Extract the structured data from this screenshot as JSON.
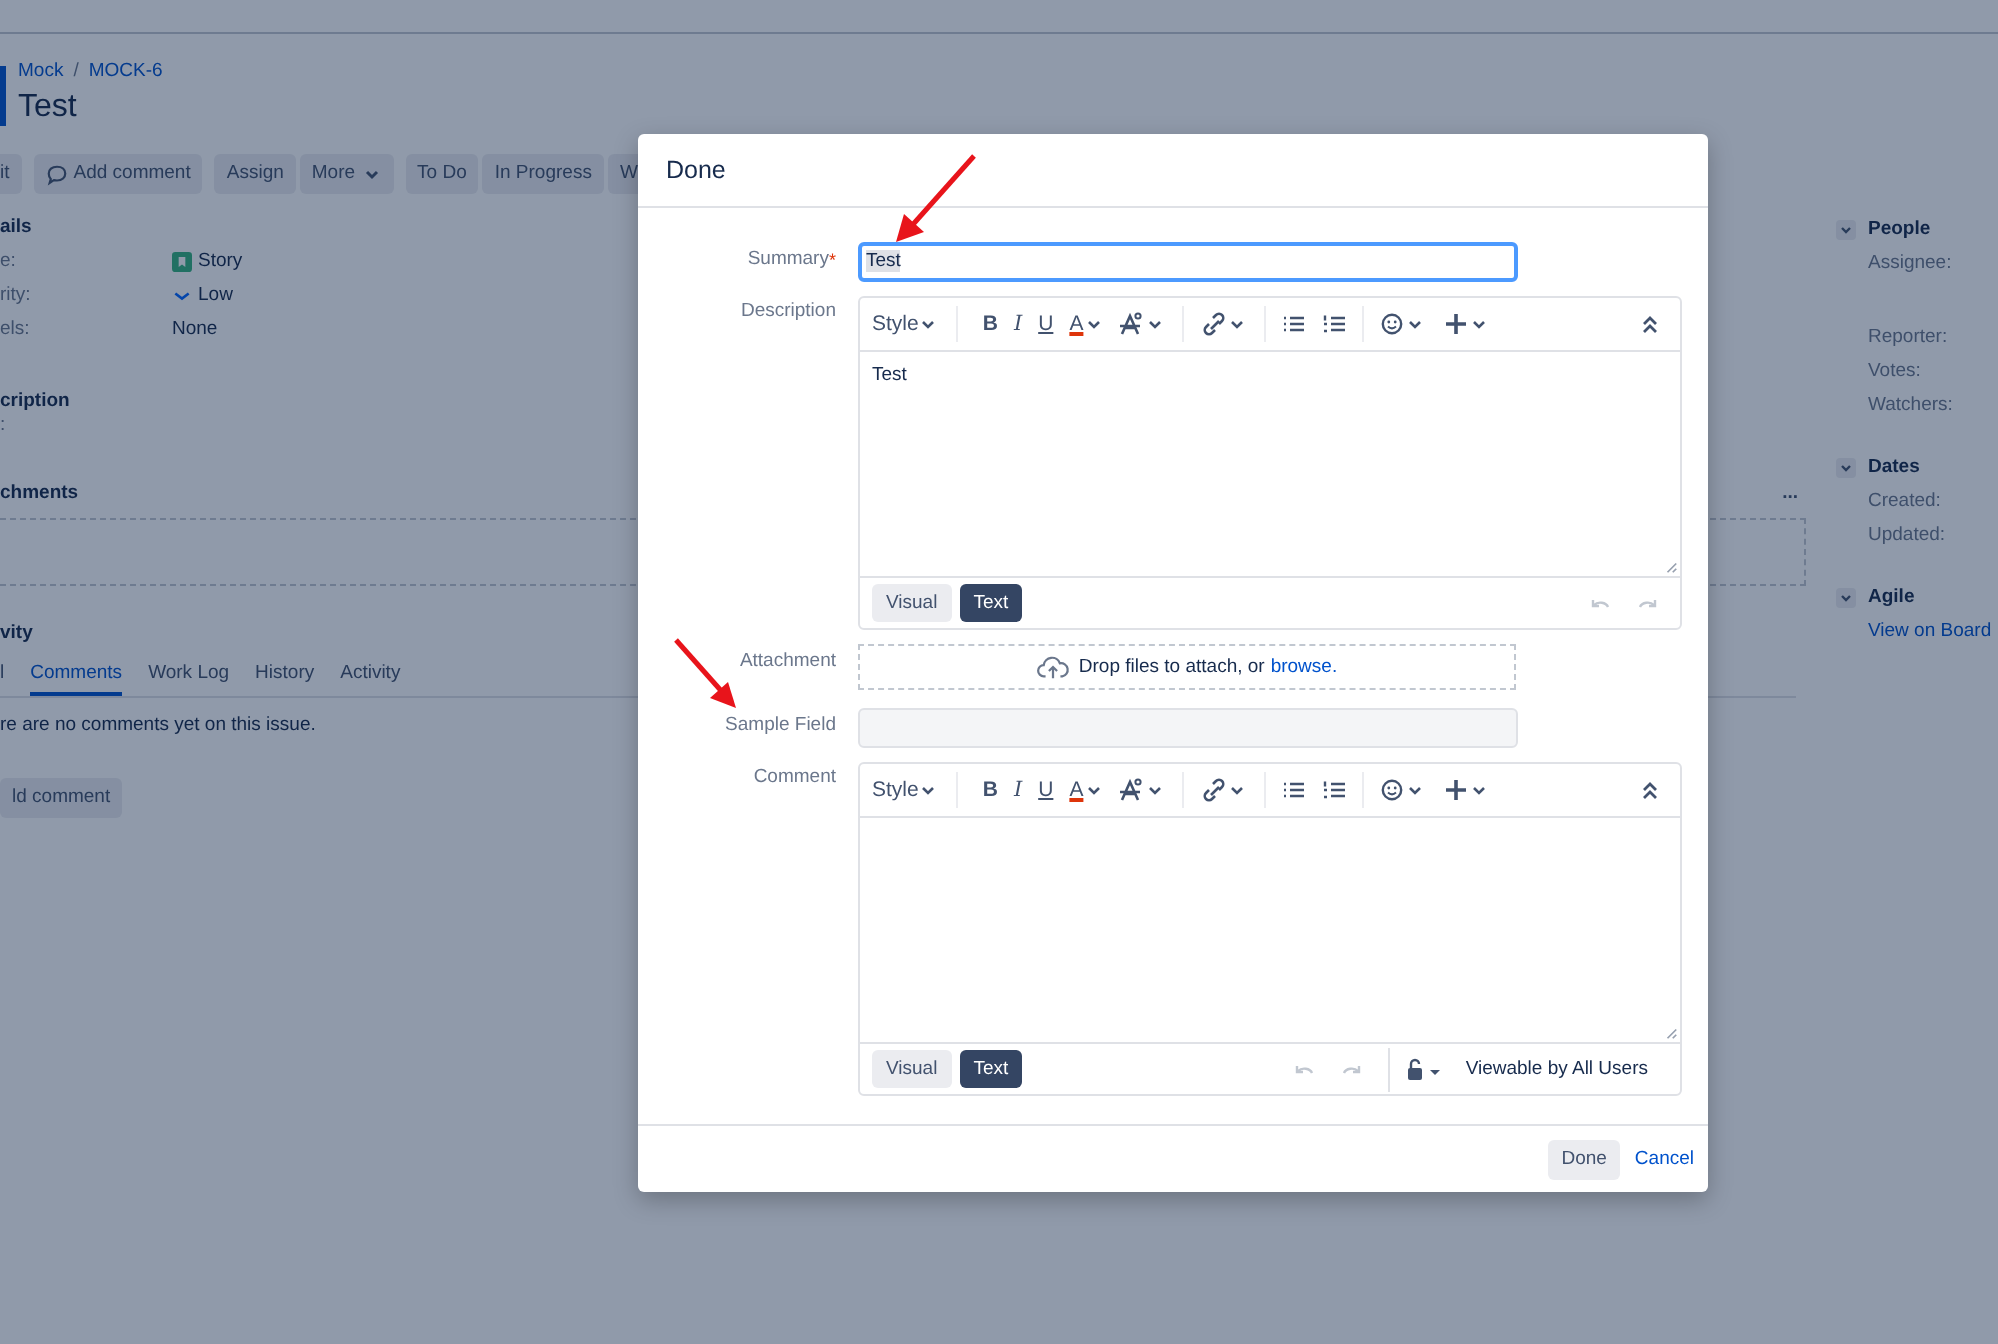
{
  "page": {
    "breadcrumbs": [
      "Mock",
      "MOCK-6"
    ],
    "breadcrumb_separator": "/",
    "title": "Test",
    "actions": [
      {
        "kind": "plain",
        "label": "it"
      },
      {
        "kind": "comment",
        "label": "Add comment"
      },
      {
        "kind": "plain",
        "label": "Assign"
      },
      {
        "kind": "menu",
        "label": "More"
      },
      {
        "kind": "plain",
        "label": "To Do"
      },
      {
        "kind": "plain",
        "label": "In Progress"
      },
      {
        "kind": "plain",
        "label": "W"
      }
    ],
    "details": {
      "heading": "ails",
      "fields": [
        {
          "kind": "story",
          "label": "e:",
          "value": "Story"
        },
        {
          "kind": "priority",
          "label": "rity:",
          "value": "Low"
        },
        {
          "kind": "plain",
          "label": "els:",
          "value": "None"
        }
      ]
    },
    "description": {
      "heading": "cription",
      "text": ":"
    },
    "attachments": {
      "heading": "chments",
      "menu": "..."
    },
    "activity": {
      "heading": "vity",
      "tabs": [
        {
          "label": "l",
          "selected": false
        },
        {
          "label": "Comments",
          "selected": true
        },
        {
          "label": "Work Log",
          "selected": false
        },
        {
          "label": "History",
          "selected": false
        },
        {
          "label": "Activity",
          "selected": false
        }
      ],
      "empty_text": "re are no comments yet on this issue.",
      "add_button": "ld comment"
    }
  },
  "sidebar": [
    {
      "heading": "People",
      "expanded": true,
      "items": [
        {
          "kind": "label",
          "text": "Assignee:"
        },
        {
          "kind": "spacer"
        },
        {
          "kind": "label",
          "text": "Reporter:"
        },
        {
          "kind": "label",
          "text": "Votes:"
        },
        {
          "kind": "label",
          "text": "Watchers:"
        }
      ]
    },
    {
      "heading": "Dates",
      "expanded": true,
      "items": [
        {
          "kind": "label",
          "text": "Created:"
        },
        {
          "kind": "label",
          "text": "Updated:"
        }
      ]
    },
    {
      "heading": "Agile",
      "expanded": true,
      "items": [
        {
          "kind": "link",
          "text": "View on Board"
        }
      ]
    }
  ],
  "dialog": {
    "title": "Done",
    "fields": [
      {
        "kind": "text",
        "label": "Summary",
        "required_mark": "*",
        "value": "Test",
        "focused": true
      },
      {
        "kind": "editor",
        "label": "Description",
        "value": "Test",
        "toolbar": [
          {
            "kind": "style",
            "label": "Style"
          },
          {
            "kind": "bold",
            "label": "B"
          },
          {
            "kind": "italic",
            "label": "I"
          },
          {
            "kind": "underline",
            "label": "U"
          },
          {
            "kind": "color",
            "label": "A"
          },
          {
            "kind": "format"
          },
          {
            "kind": "link"
          },
          {
            "kind": "bullets"
          },
          {
            "kind": "numbers"
          },
          {
            "kind": "emoji"
          },
          {
            "kind": "insert"
          },
          {
            "kind": "collapse"
          }
        ],
        "modes": [
          {
            "label": "Visual",
            "selected": false
          },
          {
            "label": "Text",
            "selected": true
          }
        ]
      },
      {
        "kind": "attachment",
        "label": "Attachment",
        "text": "Drop files to attach, or",
        "link": "browse."
      },
      {
        "kind": "text",
        "label": "Sample Field",
        "focused": false
      },
      {
        "kind": "editor",
        "label": "Comment",
        "toolbar": [
          {
            "kind": "style",
            "label": "Style"
          },
          {
            "kind": "bold",
            "label": "B"
          },
          {
            "kind": "italic",
            "label": "I"
          },
          {
            "kind": "underline",
            "label": "U"
          },
          {
            "kind": "color",
            "label": "A"
          },
          {
            "kind": "format"
          },
          {
            "kind": "link"
          },
          {
            "kind": "bullets"
          },
          {
            "kind": "numbers"
          },
          {
            "kind": "emoji"
          },
          {
            "kind": "insert"
          },
          {
            "kind": "collapse"
          }
        ],
        "modes": [
          {
            "label": "Visual",
            "selected": false
          },
          {
            "label": "Text",
            "selected": true
          }
        ],
        "visibility": "Viewable by All Users"
      }
    ],
    "buttons": [
      {
        "kind": "primary",
        "label": "Done"
      },
      {
        "kind": "link",
        "label": "Cancel"
      }
    ]
  }
}
